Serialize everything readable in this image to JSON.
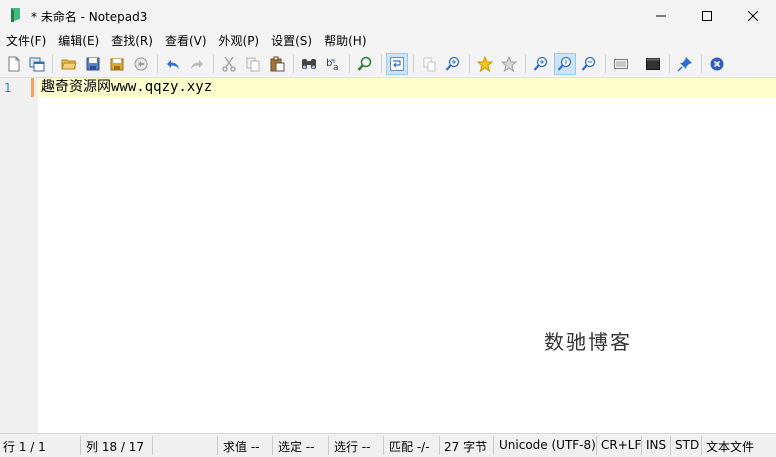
{
  "window": {
    "title": "* 未命名 - Notepad3"
  },
  "menu": [
    {
      "label": "文件(F)"
    },
    {
      "label": "编辑(E)"
    },
    {
      "label": "查找(R)"
    },
    {
      "label": "查看(V)"
    },
    {
      "label": "外观(P)"
    },
    {
      "label": "设置(S)"
    },
    {
      "label": "帮助(H)"
    }
  ],
  "toolbar": {
    "icons": [
      "new-file-icon",
      "new-window-icon",
      "open-folder-icon",
      "save-icon",
      "save-as-icon",
      "revert-icon",
      "undo-icon",
      "redo-icon",
      "cut-icon",
      "copy-icon",
      "paste-icon",
      "find-icon",
      "replace-icon",
      "goto-icon",
      "word-wrap-icon",
      "monitor-change-icon",
      "zoom-selection-icon",
      "toggle-bookmark-icon",
      "clear-bookmarks-icon",
      "zoom-in-icon",
      "zoom-reset-icon",
      "zoom-out-icon",
      "scheme-icon",
      "console-icon",
      "pin-icon",
      "close-icon"
    ]
  },
  "editor": {
    "line_number": "1",
    "line1": "趣奇资源网www.qqzy.xyz",
    "watermark": "数驰博客"
  },
  "status": {
    "line": "行  1 / 1",
    "col": "列  18 / 17",
    "value": "求值  --",
    "sel": "选定  --",
    "selline": "选行  --",
    "match": "匹配  -/-",
    "bytes": "27 字节",
    "encoding": "Unicode (UTF-8)",
    "eol": "CR+LF",
    "ins": "INS",
    "std": "STD",
    "filetype": "文本文件"
  },
  "colors": {
    "current_line": "#ffffcc",
    "line_number": "#2b91af",
    "accent": "#0078d7"
  }
}
